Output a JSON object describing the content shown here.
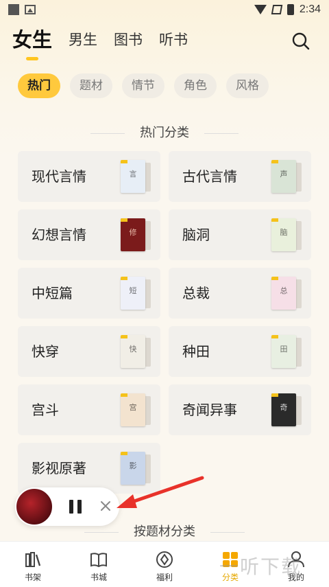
{
  "status_bar": {
    "time": "2:34"
  },
  "top_tabs": [
    {
      "label": "女生",
      "active": true
    },
    {
      "label": "男生",
      "active": false
    },
    {
      "label": "图书",
      "active": false
    },
    {
      "label": "听书",
      "active": false
    }
  ],
  "chips": [
    {
      "label": "热门",
      "active": true
    },
    {
      "label": "题材",
      "active": false
    },
    {
      "label": "情节",
      "active": false
    },
    {
      "label": "角色",
      "active": false
    },
    {
      "label": "风格",
      "active": false
    }
  ],
  "sections": {
    "hot": "热门分类",
    "theme": "按题材分类"
  },
  "categories": [
    {
      "label": "现代言情",
      "cover_color": "#e7eef6",
      "cover_text": "言"
    },
    {
      "label": "古代言情",
      "cover_color": "#d9e4d6",
      "cover_text": "声"
    },
    {
      "label": "幻想言情",
      "cover_color": "#7b1b1b",
      "cover_text": "修"
    },
    {
      "label": "脑洞",
      "cover_color": "#e9f0dc",
      "cover_text": "脑"
    },
    {
      "label": "中短篇",
      "cover_color": "#eef0f8",
      "cover_text": "短"
    },
    {
      "label": "总裁",
      "cover_color": "#f6dfe7",
      "cover_text": "总"
    },
    {
      "label": "快穿",
      "cover_color": "#f1eee6",
      "cover_text": "快"
    },
    {
      "label": "种田",
      "cover_color": "#e8efe2",
      "cover_text": "田"
    },
    {
      "label": "宫斗",
      "cover_color": "#f3e3cf",
      "cover_text": "宫"
    },
    {
      "label": "奇闻异事",
      "cover_color": "#2a2a2a",
      "cover_text": "奇"
    },
    {
      "label": "影视原著",
      "cover_color": "#c9d6ea",
      "cover_text": "影"
    }
  ],
  "bottom_nav": [
    {
      "label": "书架",
      "icon": "bookshelf-icon",
      "active": false
    },
    {
      "label": "书城",
      "icon": "book-open-icon",
      "active": false
    },
    {
      "label": "福利",
      "icon": "gift-compass-icon",
      "active": false
    },
    {
      "label": "分类",
      "icon": "category-grid-icon",
      "active": true
    },
    {
      "label": "我的",
      "icon": "profile-icon",
      "active": false
    }
  ],
  "watermark": "一听下载",
  "colors": {
    "accent": "#ffc520",
    "chip_active": "#ffc93d",
    "arrow": "#e8322a"
  }
}
